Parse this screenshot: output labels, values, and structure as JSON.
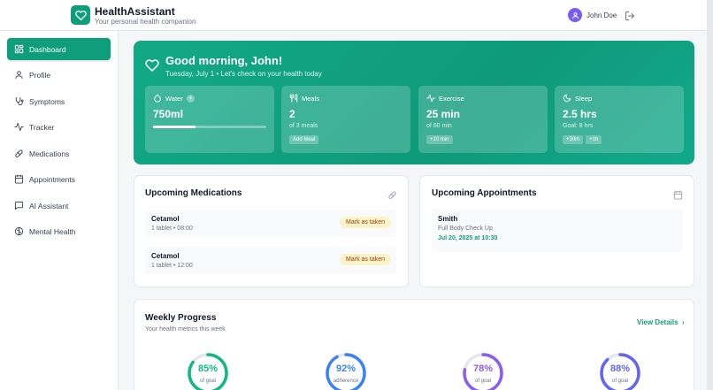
{
  "header": {
    "app_title": "HealthAssistant",
    "app_subtitle": "Your personal health companion",
    "user_name": "John Doe",
    "avatar_icon": "user-icon",
    "logout_icon": "logout-icon"
  },
  "sidebar": {
    "items": [
      {
        "label": "Dashboard",
        "icon": "grid-icon",
        "active": true
      },
      {
        "label": "Profile",
        "icon": "user-icon"
      },
      {
        "label": "Symptoms",
        "icon": "stethoscope-icon"
      },
      {
        "label": "Tracker",
        "icon": "activity-icon"
      },
      {
        "label": "Medications",
        "icon": "pill-icon"
      },
      {
        "label": "Appointments",
        "icon": "calendar-icon"
      },
      {
        "label": "AI Assistant",
        "icon": "chat-icon"
      },
      {
        "label": "Mental Health",
        "icon": "brain-icon"
      }
    ]
  },
  "hero": {
    "greeting": "Good morning, John!",
    "subtitle": "Tuesday, July 1 • Let's check on your health today",
    "stats": {
      "water": {
        "label": "Water",
        "value": "750ml",
        "progress": 0.375
      },
      "meals": {
        "label": "Meals",
        "value": "2",
        "sub": "of 3 meals",
        "button": "Add Meal"
      },
      "exercise": {
        "label": "Exercise",
        "value": "25 min",
        "sub": "of 60 min",
        "button": "+10 min"
      },
      "sleep": {
        "label": "Sleep",
        "value": "2.5 hrs",
        "sub": "Goal: 8 hrs",
        "buttons": [
          "+30m",
          "+1h"
        ]
      }
    }
  },
  "medications": {
    "title": "Upcoming Medications",
    "items": [
      {
        "name": "Cetamol",
        "detail": "1 tablet • 08:00",
        "action": "Mark as taken"
      },
      {
        "name": "Cetamol",
        "detail": "1 tablet • 12:00",
        "action": "Mark as taken"
      }
    ]
  },
  "appointments": {
    "title": "Upcoming Appointments",
    "items": [
      {
        "name": "Smith",
        "description": "Full Body Check Up",
        "date": "Jul 20, 2025 at 10:30"
      }
    ]
  },
  "weekly_progress": {
    "title": "Weekly Progress",
    "subtitle": "Your health metrics this week",
    "view_details": "View Details",
    "rings": [
      {
        "percent_text": "85%",
        "label": "of goal",
        "value": 0.85,
        "color": "#10b981"
      },
      {
        "percent_text": "92%",
        "label": "adherence",
        "value": 0.92,
        "color": "#3b82f6"
      },
      {
        "percent_text": "78%",
        "label": "of goal",
        "value": 0.78,
        "color": "#8b5cf6"
      },
      {
        "percent_text": "88%",
        "label": "of goal",
        "value": 0.88,
        "color": "#6366f1"
      }
    ]
  },
  "colors": {
    "primary": "#0f9e7b",
    "badge_bg": "#fdf3c8",
    "badge_text": "#92400e"
  }
}
